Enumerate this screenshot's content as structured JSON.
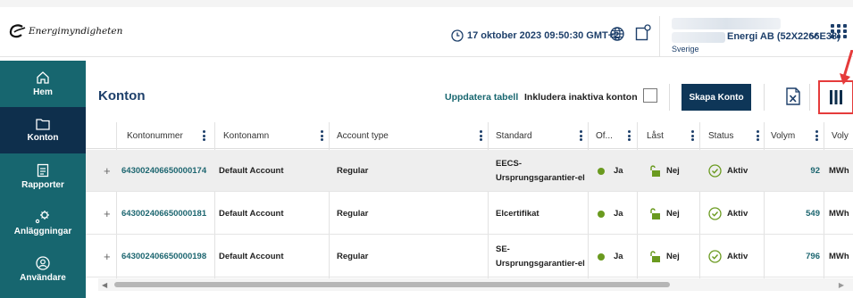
{
  "header": {
    "logo_text": "Energimyndigheten",
    "datetime": "17 oktober 2023 09:50:30 GMT+2",
    "org_name": "Energi AB (52X2266E38)",
    "org_country": "Sverige"
  },
  "sidebar": {
    "items": [
      {
        "label": "Hem",
        "icon": "home-icon"
      },
      {
        "label": "Konton",
        "icon": "folder-icon",
        "active": true
      },
      {
        "label": "Rapporter",
        "icon": "report-icon"
      },
      {
        "label": "Anläggningar",
        "icon": "facility-icon"
      },
      {
        "label": "Användare",
        "icon": "user-icon"
      }
    ]
  },
  "toolbar": {
    "title": "Konton",
    "update_link": "Uppdatera tabell",
    "include_inactive_label": "Inkludera inaktiva konton",
    "include_inactive_checked": false,
    "create_button": "Skapa Konto"
  },
  "table": {
    "columns": [
      "Kontonummer",
      "Kontonamn",
      "Account type",
      "Standard",
      "Of...",
      "Låst",
      "Status",
      "Volym",
      "Voly"
    ],
    "rows": [
      {
        "number": "643002406650000174",
        "name": "Default Account",
        "type": "Regular",
        "standard_line1": "EECS-",
        "standard_line2": "Ursprungsgarantier-el",
        "official": "Ja",
        "locked": "Nej",
        "status": "Aktiv",
        "volume": "92",
        "unit": "MWh"
      },
      {
        "number": "643002406650000181",
        "name": "Default Account",
        "type": "Regular",
        "standard_line1": "Elcertifikat",
        "standard_line2": "",
        "official": "Ja",
        "locked": "Nej",
        "status": "Aktiv",
        "volume": "549",
        "unit": "MWh"
      },
      {
        "number": "643002406650000198",
        "name": "Default Account",
        "type": "Regular",
        "standard_line1": "SE-",
        "standard_line2": "Ursprungsgarantier-el",
        "official": "Ja",
        "locked": "Nej",
        "status": "Aktiv",
        "volume": "796",
        "unit": "MWh"
      }
    ]
  },
  "colors": {
    "sidebar": "#17666f",
    "sidebar_active": "#0e2f4c",
    "primary_text": "#1d3f6a",
    "link": "#1d6670",
    "button": "#0e3658",
    "status_green": "#6a9a1f",
    "highlight": "#e53b3b"
  }
}
